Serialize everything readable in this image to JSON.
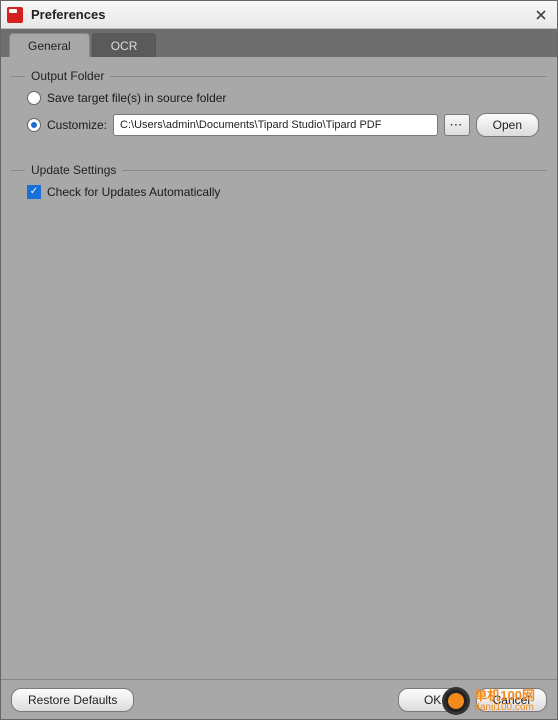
{
  "window": {
    "title": "Preferences"
  },
  "tabs": {
    "general": "General",
    "ocr": "OCR"
  },
  "output": {
    "legend": "Output Folder",
    "save_in_source": "Save target file(s) in source folder",
    "customize": "Customize:",
    "path": "C:\\Users\\admin\\Documents\\Tipard Studio\\Tipard PDF",
    "browse": "···",
    "open": "Open"
  },
  "update": {
    "legend": "Update Settings",
    "auto_check": "Check for Updates Automatically"
  },
  "footer": {
    "restore": "Restore Defaults",
    "ok": "OK",
    "cancel": "Cancel"
  },
  "watermark": {
    "line1": "单机100网",
    "line2": "danji100.com"
  }
}
